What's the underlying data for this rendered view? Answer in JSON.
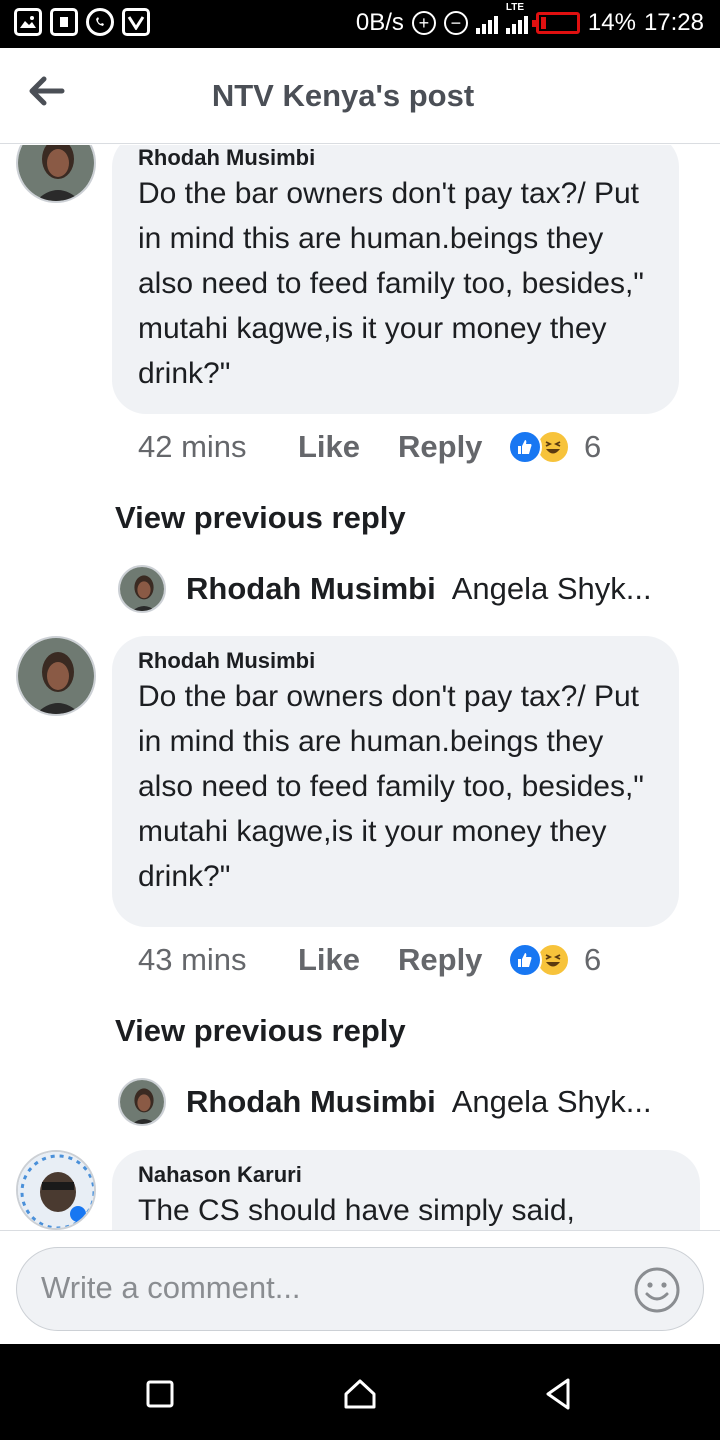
{
  "status_bar": {
    "left_icons": [
      "gallery-icon",
      "sim-icon",
      "whatsapp-icon",
      "vpn-icon"
    ],
    "net_speed": "0B/s",
    "lte_label": "LTE",
    "battery": "14%",
    "time": "17:28",
    "battery_color": "#e01010"
  },
  "header": {
    "title": "NTV Kenya's post",
    "back_icon": "arrow-left-icon"
  },
  "comments": [
    {
      "author": "Rhodah Musimbi",
      "text": "Do the bar owners don't pay tax?/ Put in mind this are human.beings they also need to feed family too, besides,\" mutahi kagwe,is it your money they drink?\"",
      "time": "42 mins",
      "like_label": "Like",
      "reply_label": "Reply",
      "reactions": [
        "like",
        "haha"
      ],
      "reaction_count": "6",
      "view_previous": "View previous reply",
      "reply_preview": {
        "author": "Rhodah Musimbi",
        "text": "Angela Shyk..."
      }
    },
    {
      "author": "Rhodah Musimbi",
      "text": "Do the bar owners don't pay tax?/ Put in mind this are human.beings they also need to feed family too, besides,\" mutahi kagwe,is it your money they drink?\"",
      "time": "43 mins",
      "like_label": "Like",
      "reply_label": "Reply",
      "reactions": [
        "like",
        "haha"
      ],
      "reaction_count": "6",
      "view_previous": "View previous reply",
      "reply_preview": {
        "author": "Rhodah Musimbi",
        "text": "Angela Shyk..."
      }
    },
    {
      "author": "Nahason Karuri",
      "text": "The CS should have simply said,"
    }
  ],
  "composer": {
    "placeholder": "Write a comment...",
    "emoji_icon": "smiley-icon"
  },
  "nav": [
    "recents-icon",
    "home-icon",
    "back-triangle-icon"
  ],
  "colors": {
    "accent": "#1877f2",
    "bubble": "#f0f2f5",
    "meta_text": "#65676b"
  }
}
